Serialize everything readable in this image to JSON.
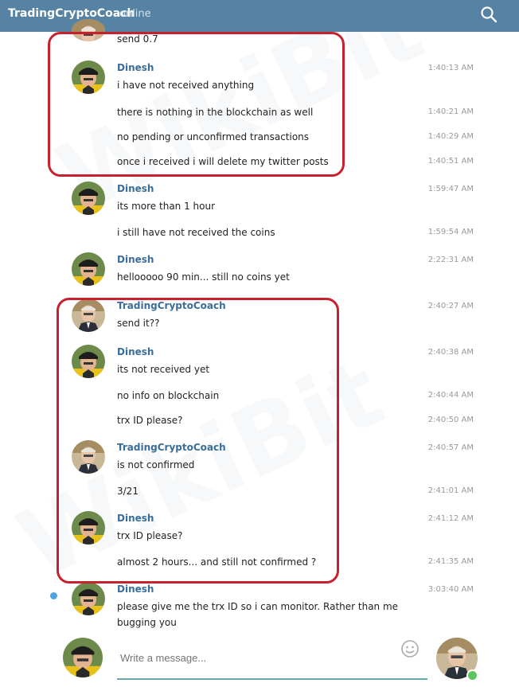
{
  "header": {
    "chat_name": "TradingCryptoCoach",
    "status": "online"
  },
  "messages": [
    {
      "author": "",
      "text": "send 0.7",
      "time": "",
      "avatar": "coach"
    },
    {
      "author": "Dinesh",
      "text": "i have not received anything",
      "time": "1:40:13 AM",
      "avatar": "dinesh"
    },
    {
      "author": "",
      "text": "there is nothing in the blockchain as well",
      "time": "1:40:21 AM",
      "avatar": ""
    },
    {
      "author": "",
      "text": "no pending or unconfirmed transactions",
      "time": "1:40:29 AM",
      "avatar": ""
    },
    {
      "author": "",
      "text": "once i received i will delete my twitter posts",
      "time": "1:40:51 AM",
      "avatar": ""
    },
    {
      "author": "Dinesh",
      "text": "its more than 1 hour",
      "time": "1:59:47 AM",
      "avatar": "dinesh"
    },
    {
      "author": "",
      "text": "i still have not received the coins",
      "time": "1:59:54 AM",
      "avatar": ""
    },
    {
      "author": "Dinesh",
      "text": "hellooooo 90 min... still no coins yet",
      "time": "2:22:31 AM",
      "avatar": "dinesh"
    },
    {
      "author": "TradingCryptoCoach",
      "text": "send it??",
      "time": "2:40:27 AM",
      "avatar": "coach"
    },
    {
      "author": "Dinesh",
      "text": "its not received yet",
      "time": "2:40:38 AM",
      "avatar": "dinesh"
    },
    {
      "author": "",
      "text": "no info on blockchain",
      "time": "2:40:44 AM",
      "avatar": ""
    },
    {
      "author": "",
      "text": "trx ID please?",
      "time": "2:40:50 AM",
      "avatar": ""
    },
    {
      "author": "TradingCryptoCoach",
      "text": "is not confirmed",
      "time": "2:40:57 AM",
      "avatar": "coach"
    },
    {
      "author": "",
      "text": "3/21",
      "time": "2:41:01 AM",
      "avatar": ""
    },
    {
      "author": "Dinesh",
      "text": "trx ID please?",
      "time": "2:41:12 AM",
      "avatar": "dinesh"
    },
    {
      "author": "",
      "text": "almost 2 hours... and still not confirmed ?",
      "time": "2:41:35 AM",
      "avatar": ""
    },
    {
      "author": "Dinesh",
      "text": "please give me the trx ID so i can monitor. Rather than me",
      "text2": "bugging you",
      "time": "3:03:40 AM",
      "avatar": "dinesh"
    }
  ],
  "composer": {
    "placeholder": "Write a message..."
  },
  "watermark": "WikiBit",
  "colors": {
    "header": "#5682a3",
    "author": "#3a6d99",
    "highlight": "#c8202d",
    "online": "#5cc55f"
  }
}
